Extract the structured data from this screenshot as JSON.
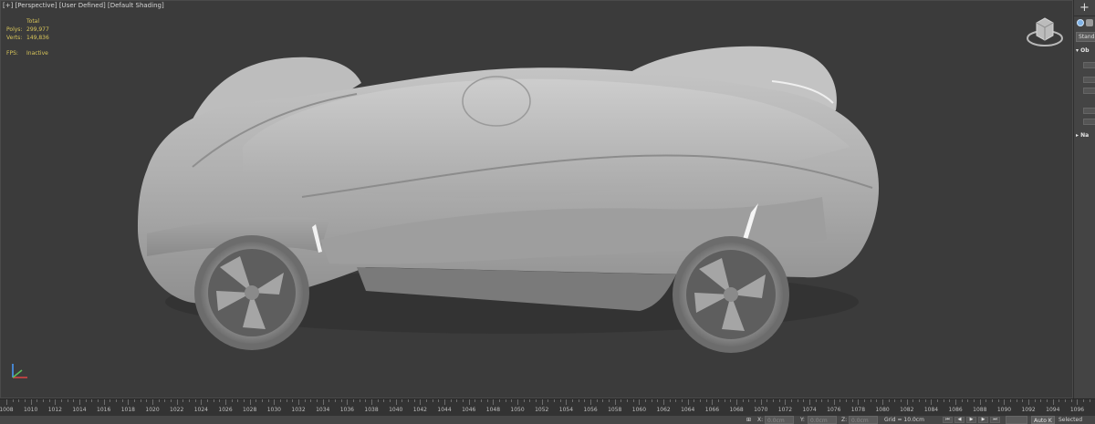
{
  "viewport": {
    "label_parts": [
      "[+]",
      "[Perspective]",
      "[User Defined]",
      "[Default Shading]"
    ],
    "stats": {
      "total_label": "Total",
      "polys_label": "Polys:",
      "polys_value": "299,977",
      "verts_label": "Verts:",
      "verts_value": "149,836",
      "fps_label": "FPS:",
      "fps_value": "Inactive"
    },
    "viewcube_icon": "viewcube-navigation",
    "axis_icon": "xyz-axis-tripod"
  },
  "command_panel": {
    "add_symbol": "+",
    "dropdown_value": "Standa",
    "rollout_object_type": "Ob",
    "rollout_name": "Na"
  },
  "timeline": {
    "frames": [
      "1008",
      "1010",
      "1012",
      "1014",
      "1016",
      "1018",
      "1020",
      "1022",
      "1024",
      "1026",
      "1028",
      "1030",
      "1032",
      "1034",
      "1036",
      "1038",
      "1040",
      "1042",
      "1044",
      "1046",
      "1048",
      "1050",
      "1052",
      "1054",
      "1056",
      "1058",
      "1060",
      "1062",
      "1064",
      "1066",
      "1068",
      "1070",
      "1072",
      "1074",
      "1076",
      "1078",
      "1080",
      "1082",
      "1084",
      "1086",
      "1088",
      "1090",
      "1092",
      "1094",
      "1096"
    ]
  },
  "statusbar": {
    "x_label": "X:",
    "x_value": "0.0cm",
    "y_label": "Y:",
    "y_value": "0.0cm",
    "z_label": "Z:",
    "z_value": "0.0cm",
    "grid_label": "Grid = 10.0cm",
    "autokey_label": "Auto K",
    "selected_label": "Selected"
  },
  "colors": {
    "viewport_bg": "#3b3b3b",
    "stats_text": "#d8c55a",
    "panel_bg": "#444444",
    "timeline_bg": "#333333",
    "statusbar_bg": "#474747"
  }
}
